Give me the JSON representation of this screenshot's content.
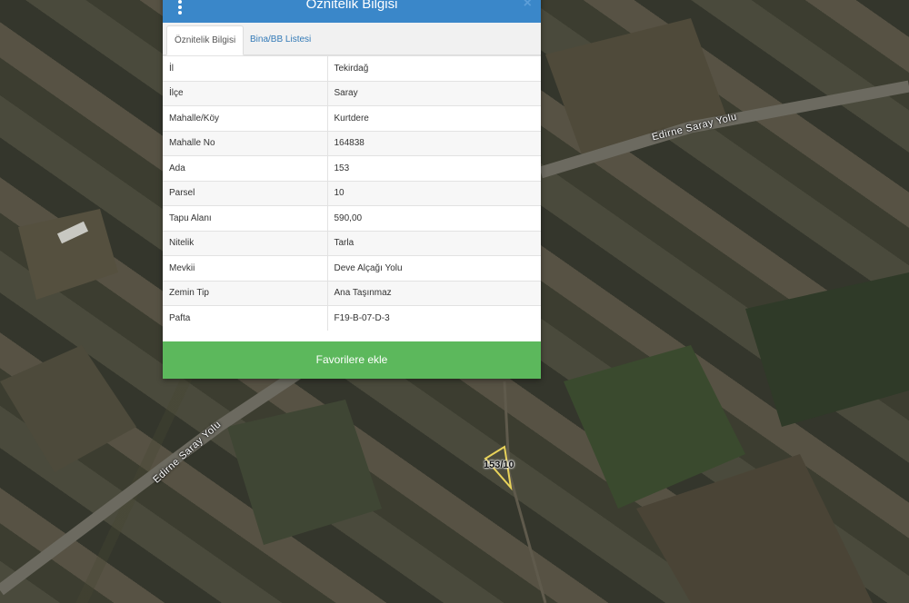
{
  "map": {
    "road_labels": [
      "Edirne Saray Yolu",
      "Edirne Saray Yolu"
    ],
    "parcel_label": "153/10"
  },
  "panel": {
    "title": "Öznitelik Bilgisi",
    "close_symbol": "×",
    "menu_icon": "vertical-dots-icon",
    "tabs": [
      {
        "label": "Öznitelik Bilgisi",
        "active": true
      },
      {
        "label": "Bina/BB Listesi",
        "active": false
      }
    ],
    "rows": [
      {
        "key": "İl",
        "value": "Tekirdağ"
      },
      {
        "key": "İlçe",
        "value": "Saray"
      },
      {
        "key": "Mahalle/Köy",
        "value": "Kurtdere"
      },
      {
        "key": "Mahalle No",
        "value": "164838"
      },
      {
        "key": "Ada",
        "value": "153"
      },
      {
        "key": "Parsel",
        "value": "10"
      },
      {
        "key": "Tapu Alanı",
        "value": "590,00"
      },
      {
        "key": "Nitelik",
        "value": "Tarla"
      },
      {
        "key": "Mevkii",
        "value": "Deve Alçağı Yolu"
      },
      {
        "key": "Zemin Tip",
        "value": "Ana Taşınmaz"
      },
      {
        "key": "Pafta",
        "value": "F19-B-07-D-3"
      }
    ],
    "favorite_button": "Favorilere ekle"
  },
  "colors": {
    "header": "#3a87c9",
    "button": "#5cb85c",
    "parcel_outline": "#e8d25a"
  }
}
